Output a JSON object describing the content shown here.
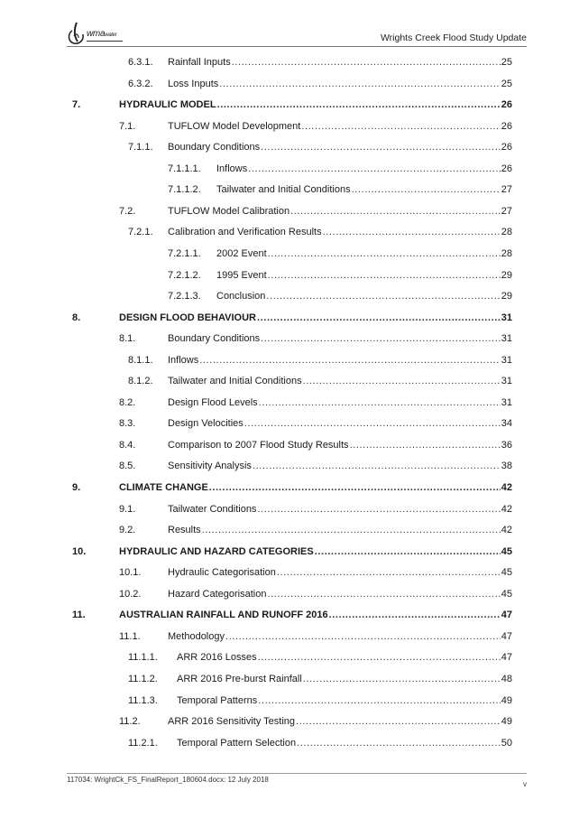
{
  "header": {
    "logo_text": "wma",
    "logo_suffix": "water",
    "title": "Wrights Creek Flood Study Update"
  },
  "toc": [
    {
      "level": 3,
      "number": "6.3.1.",
      "title": "Rainfall Inputs",
      "page": "25"
    },
    {
      "level": 3,
      "number": "6.3.2.",
      "title": "Loss Inputs",
      "page": "25"
    },
    {
      "level": 1,
      "number": "7.",
      "title": "HYDRAULIC MODEL",
      "page": "26"
    },
    {
      "level": 2,
      "number": "7.1.",
      "title": "TUFLOW Model Development",
      "page": "26"
    },
    {
      "level": 3,
      "number": "7.1.1.",
      "title": "Boundary Conditions",
      "page": "26"
    },
    {
      "level": 4,
      "number": "7.1.1.1.",
      "title": "Inflows",
      "page": "26"
    },
    {
      "level": 4,
      "number": "7.1.1.2.",
      "title": "Tailwater and Initial Conditions",
      "page": "27"
    },
    {
      "level": 2,
      "number": "7.2.",
      "title": "TUFLOW Model Calibration",
      "page": "27"
    },
    {
      "level": 3,
      "number": "7.2.1.",
      "title": "Calibration and Verification Results",
      "page": "28"
    },
    {
      "level": 4,
      "number": "7.2.1.1.",
      "title": "2002 Event",
      "page": "28"
    },
    {
      "level": 4,
      "number": "7.2.1.2.",
      "title": "1995 Event",
      "page": "29"
    },
    {
      "level": 4,
      "number": "7.2.1.3.",
      "title": "Conclusion",
      "page": "29"
    },
    {
      "level": 1,
      "number": "8.",
      "title": "DESIGN FLOOD BEHAVIOUR",
      "page": "31"
    },
    {
      "level": 2,
      "number": "8.1.",
      "title": "Boundary Conditions",
      "page": "31"
    },
    {
      "level": 3,
      "number": "8.1.1.",
      "title": "Inflows",
      "page": "31"
    },
    {
      "level": 3,
      "number": "8.1.2.",
      "title": "Tailwater and Initial Conditions",
      "page": "31"
    },
    {
      "level": 2,
      "number": "8.2.",
      "title": "Design Flood Levels",
      "page": "31"
    },
    {
      "level": 2,
      "number": "8.3.",
      "title": "Design Velocities",
      "page": "34"
    },
    {
      "level": 2,
      "number": "8.4.",
      "title": "Comparison to 2007 Flood Study Results",
      "page": "36"
    },
    {
      "level": 2,
      "number": "8.5.",
      "title": "Sensitivity Analysis",
      "page": "38"
    },
    {
      "level": 1,
      "number": "9.",
      "title": "CLIMATE CHANGE",
      "page": "42"
    },
    {
      "level": 2,
      "number": "9.1.",
      "title": "Tailwater Conditions",
      "page": "42"
    },
    {
      "level": 2,
      "number": "9.2.",
      "title": "Results",
      "page": "42"
    },
    {
      "level": 1,
      "number": "10.",
      "title": "HYDRAULIC AND HAZARD CATEGORIES",
      "page": "45"
    },
    {
      "level": 2,
      "number": "10.1.",
      "title": "Hydraulic Categorisation",
      "page": "45"
    },
    {
      "level": 2,
      "number": "10.2.",
      "title": "Hazard Categorisation",
      "page": "45"
    },
    {
      "level": 1,
      "number": "11.",
      "title": "AUSTRALIAN RAINFALL AND RUNOFF 2016",
      "page": "47"
    },
    {
      "level": 2,
      "number": "11.1.",
      "title": "Methodology",
      "page": "47"
    },
    {
      "level": 3,
      "number": "11.1.1.",
      "title": "ARR 2016 Losses",
      "page": "47",
      "wide": true
    },
    {
      "level": 3,
      "number": "11.1.2.",
      "title": "ARR 2016 Pre-burst Rainfall",
      "page": "48",
      "wide": true
    },
    {
      "level": 3,
      "number": "11.1.3.",
      "title": "Temporal Patterns",
      "page": "49",
      "wide": true
    },
    {
      "level": 2,
      "number": "11.2.",
      "title": "ARR 2016 Sensitivity Testing",
      "page": "49"
    },
    {
      "level": 3,
      "number": "11.2.1.",
      "title": "Temporal Pattern Selection",
      "page": "50",
      "wide": true
    }
  ],
  "footer": {
    "text": "117034: WrightCk_FS_FinalReport_180604.docx: 12 July 2018",
    "page": "v"
  }
}
